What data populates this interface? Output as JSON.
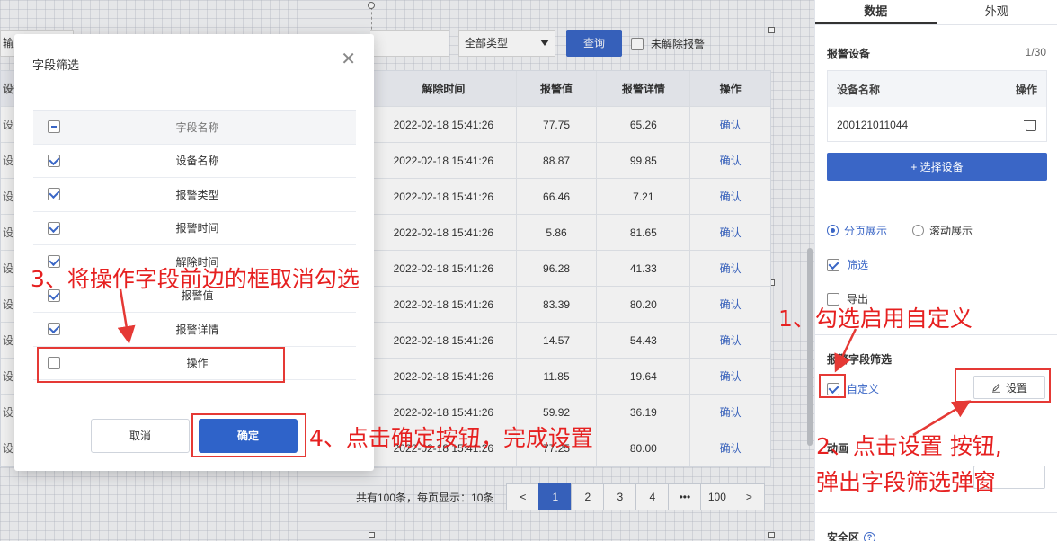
{
  "canvas": {
    "filter_input_text": "输入",
    "type_select_value": "全部类型",
    "query_label": "查询",
    "unresolved_label": "未解除报警",
    "table": {
      "headers": [
        "设备",
        "解除时间",
        "报警值",
        "报警详情",
        "操作"
      ],
      "rows": [
        {
          "c0": "设",
          "time": "2022-02-18 15:41:26",
          "value": "77.75",
          "detail": "65.26",
          "action": "确认"
        },
        {
          "c0": "设",
          "time": "2022-02-18 15:41:26",
          "value": "88.87",
          "detail": "99.85",
          "action": "确认"
        },
        {
          "c0": "设",
          "time": "2022-02-18 15:41:26",
          "value": "66.46",
          "detail": "7.21",
          "action": "确认"
        },
        {
          "c0": "设",
          "time": "2022-02-18 15:41:26",
          "value": "5.86",
          "detail": "81.65",
          "action": "确认"
        },
        {
          "c0": "设",
          "time": "2022-02-18 15:41:26",
          "value": "96.28",
          "detail": "41.33",
          "action": "确认"
        },
        {
          "c0": "设",
          "time": "2022-02-18 15:41:26",
          "value": "83.39",
          "detail": "80.20",
          "action": "确认"
        },
        {
          "c0": "设",
          "time": "2022-02-18 15:41:26",
          "value": "14.57",
          "detail": "54.43",
          "action": "确认"
        },
        {
          "c0": "设",
          "time": "2022-02-18 15:41:26",
          "value": "11.85",
          "detail": "19.64",
          "action": "确认"
        },
        {
          "c0": "设",
          "time": "2022-02-18 15:41:26",
          "value": "59.92",
          "detail": "36.19",
          "action": "确认"
        },
        {
          "c0": "设",
          "time": "2022-02-18 15:41:26",
          "value": "77.25",
          "detail": "80.00",
          "action": "确认"
        }
      ]
    },
    "pager": {
      "total_text": "共有100条，每页显示：10条",
      "prev": "<",
      "pages": [
        "1",
        "2",
        "3",
        "4",
        "•••",
        "100"
      ],
      "active_page": "1",
      "next": ">"
    }
  },
  "panel": {
    "tabs": [
      "数据",
      "外观"
    ],
    "active_tab": "数据",
    "alarm_device_title": "报警设备",
    "device_count": "1/30",
    "device_table_header_name": "设备名称",
    "device_table_header_action": "操作",
    "device_row_name": "200121011044",
    "select_device_label": "+ 选择设备",
    "paging_label": "分页展示",
    "scroll_label": "滚动展示",
    "filter_label": "筛选",
    "export_label": "导出",
    "field_filter_title": "报警字段筛选",
    "custom_label": "自定义",
    "settings_label": "设置",
    "animation_title": "动画",
    "safe_area_title": "安全区"
  },
  "modal": {
    "title": "字段筛选",
    "header": "字段名称",
    "fields": [
      {
        "name": "设备名称",
        "checked": true
      },
      {
        "name": "报警类型",
        "checked": true
      },
      {
        "name": "报警时间",
        "checked": true
      },
      {
        "name": "解除时间",
        "checked": true
      },
      {
        "name": "报警值",
        "checked": true
      },
      {
        "name": "报警详情",
        "checked": true
      },
      {
        "name": "操作",
        "checked": false
      }
    ],
    "cancel_label": "取消",
    "ok_label": "确定"
  },
  "annotations": {
    "step1": "1、勾选启用自定义",
    "step2_line1": "2、点击设置 按钮,",
    "step2_line2": "弹出字段筛选弹窗",
    "step3": "3、将操作字段前边的框取消勾选",
    "step4": "4、点击确定按钮，完成设置",
    "color": "#e62020"
  },
  "colors": {
    "primary": "#3a66c6",
    "annotation_red": "#e53935"
  }
}
